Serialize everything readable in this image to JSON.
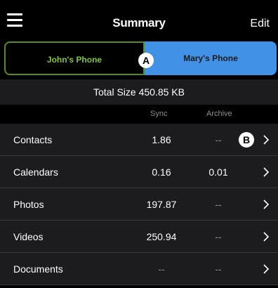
{
  "navbar": {
    "title": "Summary",
    "edit_label": "Edit",
    "menu_icon": "hamburger-menu-icon"
  },
  "segments": {
    "john_label": "John's Phone",
    "mary_label": "Mary's Phone",
    "selected": "Mary's Phone"
  },
  "callouts": {
    "a": "A",
    "b": "B"
  },
  "summary": {
    "total_size": "Total Size 450.85 KB"
  },
  "columns": {
    "sync": "Sync",
    "archive": "Archive"
  },
  "rows": [
    {
      "label": "Contacts",
      "sync": "1.86",
      "archive": "--"
    },
    {
      "label": "Calendars",
      "sync": "0.16",
      "archive": "0.01"
    },
    {
      "label": "Photos",
      "sync": "197.87",
      "archive": "--"
    },
    {
      "label": "Videos",
      "sync": "250.94",
      "archive": "--"
    },
    {
      "label": "Documents",
      "sync": "--",
      "archive": "--"
    }
  ],
  "colors": {
    "background": "#000000",
    "row_background": "#1c1c1e",
    "john_accent": "#7ec82a",
    "mary_accent": "#4192e6",
    "muted_text": "#8e8e8e"
  }
}
